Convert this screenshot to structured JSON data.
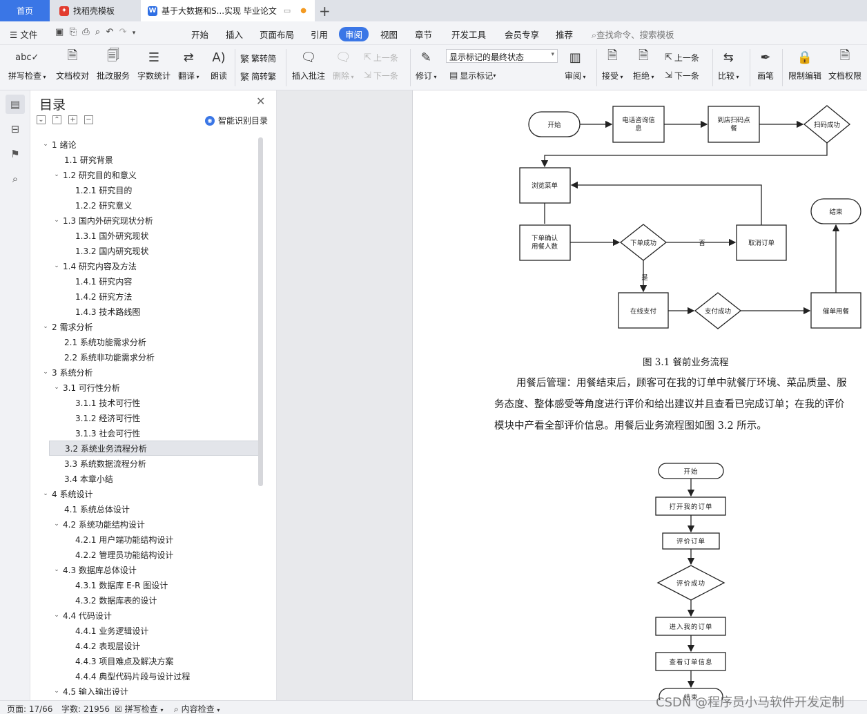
{
  "tabs": {
    "home": "首页",
    "templates": "找稻壳模板",
    "document": "基于大数据和S...实现 毕业论文"
  },
  "menu": {
    "file": "文件",
    "items": [
      "开始",
      "插入",
      "页面布局",
      "引用",
      "审阅",
      "视图",
      "章节",
      "开发工具",
      "会员专享",
      "推荐"
    ],
    "active": "审阅",
    "search_placeholder": "查找命令、搜索模板"
  },
  "ribbon": {
    "spellcheck": "拼写检查",
    "doc_proof": "文档校对",
    "batch_service": "批改服务",
    "word_count": "字数统计",
    "translate": "翻译",
    "read_aloud": "朗读",
    "trad_convert": "繁转简",
    "simp_convert": "简转繁",
    "insert_comment": "插入批注",
    "delete": "删除",
    "prev": "上一条",
    "next": "下一条",
    "revise": "修订",
    "markup_state": "显示标记的最终状态",
    "show_markup": "显示标记",
    "review": "审阅",
    "accept": "接受",
    "reject": "拒绝",
    "prev2": "上一条",
    "next2": "下一条",
    "compare": "比较",
    "pen": "画笔",
    "restrict_edit": "限制编辑",
    "doc_permission": "文档权限"
  },
  "toc": {
    "title": "目录",
    "smart_label": "智能识别目录",
    "items": [
      {
        "text": "1  绪论",
        "level": 1,
        "chev": true
      },
      {
        "text": "1.1 研究背景",
        "level": 2,
        "chev": false
      },
      {
        "text": "1.2 研究目的和意义",
        "level": 2,
        "chev": true
      },
      {
        "text": "1.2.1 研究目的",
        "level": 3,
        "chev": false
      },
      {
        "text": "1.2.2 研究意义",
        "level": 3,
        "chev": false
      },
      {
        "text": "1.3 国内外研究现状分析",
        "level": 2,
        "chev": true
      },
      {
        "text": "1.3.1 国外研究现状",
        "level": 3,
        "chev": false
      },
      {
        "text": "1.3.2 国内研究现状",
        "level": 3,
        "chev": false
      },
      {
        "text": "1.4 研究内容及方法",
        "level": 2,
        "chev": true
      },
      {
        "text": "1.4.1 研究内容",
        "level": 3,
        "chev": false
      },
      {
        "text": "1.4.2 研究方法",
        "level": 3,
        "chev": false
      },
      {
        "text": "1.4.3 技术路线图",
        "level": 3,
        "chev": false
      },
      {
        "text": "2  需求分析",
        "level": 1,
        "chev": true
      },
      {
        "text": "2.1 系统功能需求分析",
        "level": 2,
        "chev": false
      },
      {
        "text": "2.2 系统非功能需求分析",
        "level": 2,
        "chev": false
      },
      {
        "text": "3  系统分析",
        "level": 1,
        "chev": true
      },
      {
        "text": "3.1 可行性分析",
        "level": 2,
        "chev": true
      },
      {
        "text": "3.1.1 技术可行性",
        "level": 3,
        "chev": false
      },
      {
        "text": "3.1.2 经济可行性",
        "level": 3,
        "chev": false
      },
      {
        "text": "3.1.3 社会可行性",
        "level": 3,
        "chev": false
      },
      {
        "text": "3.2 系统业务流程分析",
        "level": 2,
        "chev": false,
        "selected": true
      },
      {
        "text": "3.3 系统数据流程分析",
        "level": 2,
        "chev": false
      },
      {
        "text": "3.4 本章小结",
        "level": 2,
        "chev": false
      },
      {
        "text": "4  系统设计",
        "level": 1,
        "chev": true
      },
      {
        "text": "4.1 系统总体设计",
        "level": 2,
        "chev": false
      },
      {
        "text": "4.2 系统功能结构设计",
        "level": 2,
        "chev": true
      },
      {
        "text": "4.2.1 用户端功能结构设计",
        "level": 3,
        "chev": false
      },
      {
        "text": "4.2.2 管理员功能结构设计",
        "level": 3,
        "chev": false
      },
      {
        "text": "4.3 数据库总体设计",
        "level": 2,
        "chev": true
      },
      {
        "text": "4.3.1  数据库 E-R 图设计",
        "level": 3,
        "chev": false
      },
      {
        "text": "4.3.2  数据库表的设计",
        "level": 3,
        "chev": false
      },
      {
        "text": "4.4 代码设计",
        "level": 2,
        "chev": true
      },
      {
        "text": "4.4.1 业务逻辑设计",
        "level": 3,
        "chev": false
      },
      {
        "text": "4.4.2 表现层设计",
        "level": 3,
        "chev": false
      },
      {
        "text": "4.4.3 项目难点及解决方案",
        "level": 3,
        "chev": false
      },
      {
        "text": "4.4.4 典型代码片段与设计过程",
        "level": 3,
        "chev": false
      },
      {
        "text": "4.5 输入输出设计",
        "level": 2,
        "chev": true
      }
    ]
  },
  "document": {
    "flow1": {
      "start": "开始",
      "phone": [
        "电话咨询信",
        "息"
      ],
      "scan": [
        "到店扫码点",
        "餐"
      ],
      "scan_ok": "扫码成功",
      "browse": "浏览菜单",
      "confirm": [
        "下单确认",
        "用餐人数"
      ],
      "order_ok": "下单成功",
      "no": "否",
      "cancel": "取消订单",
      "yes": "是",
      "end": "结束",
      "pay": "在线支付",
      "pay_ok": "支付成功",
      "urge": "催单用餐"
    },
    "caption": "图 3.1  餐前业务流程",
    "para": [
      "用餐后管理：用餐结束后，顾客可在我的订单中就餐厅环境、菜品质量、服",
      "务态度、整体感受等角度进行评价和给出建议并且查看已完成订单；在我的评价",
      "模块中产看全部评价信息。用餐后业务流程图如图 3.2 所示。"
    ],
    "flow2": {
      "start": "开始",
      "open": "打开我的订单",
      "rate": "评价订单",
      "rate_ok": "评价成功",
      "enter": "进入我的订单",
      "view": "查看订单信息",
      "end": "结束"
    }
  },
  "status": {
    "page": "页面: 17/66",
    "words": "字数: 21956",
    "spell": "拼写检查",
    "content": "内容检查"
  },
  "watermark": "CSDN @程序员小马软件开发定制"
}
